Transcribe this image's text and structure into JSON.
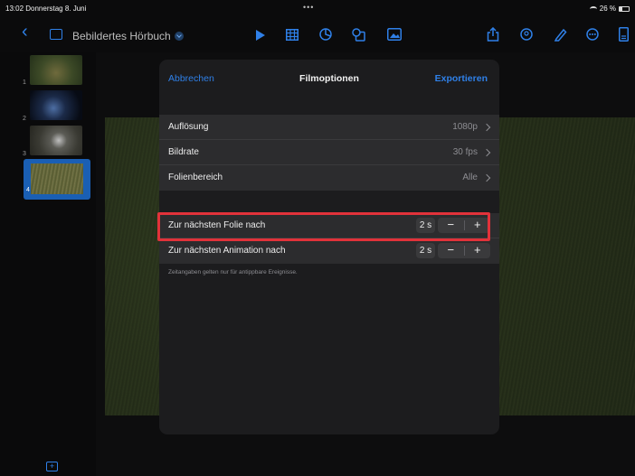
{
  "statusbar": {
    "time": "13:02  Donnerstag 8. Juni",
    "dots": "•••",
    "battery": "26 %"
  },
  "toolbar": {
    "back_glyph": "‹",
    "document_title": "Bebildertes Hörbuch",
    "icons": [
      "sidebar-icon",
      "play-icon",
      "table-icon",
      "chart-icon",
      "shapes-icon",
      "media-icon",
      "share-icon",
      "collaborate-icon",
      "format-icon",
      "more-icon",
      "document-icon"
    ],
    "accent_color": "#2f80e8"
  },
  "sidebar": {
    "slides": [
      {
        "number": "1",
        "selected": false
      },
      {
        "number": "2",
        "selected": false
      },
      {
        "number": "3",
        "selected": false
      },
      {
        "number": "4",
        "selected": true
      }
    ],
    "add_icon": "+"
  },
  "dialog": {
    "cancel": "Abbrechen",
    "title": "Filmoptionen",
    "export": "Exportieren",
    "settings": [
      {
        "label": "Auflösung",
        "value": "1080p"
      },
      {
        "label": "Bildrate",
        "value": "30 fps"
      },
      {
        "label": "Folienbereich",
        "value": "Alle"
      }
    ],
    "timing": [
      {
        "label": "Zur nächsten Folie nach",
        "value": "2 s",
        "minus": "−",
        "plus": "+"
      },
      {
        "label": "Zur nächsten Animation nach",
        "value": "2 s",
        "minus": "−",
        "plus": "+"
      }
    ],
    "footnote": "Zeitangaben gelten nur für antippbare Ereignisse.",
    "highlight_color": "#e2323a"
  }
}
